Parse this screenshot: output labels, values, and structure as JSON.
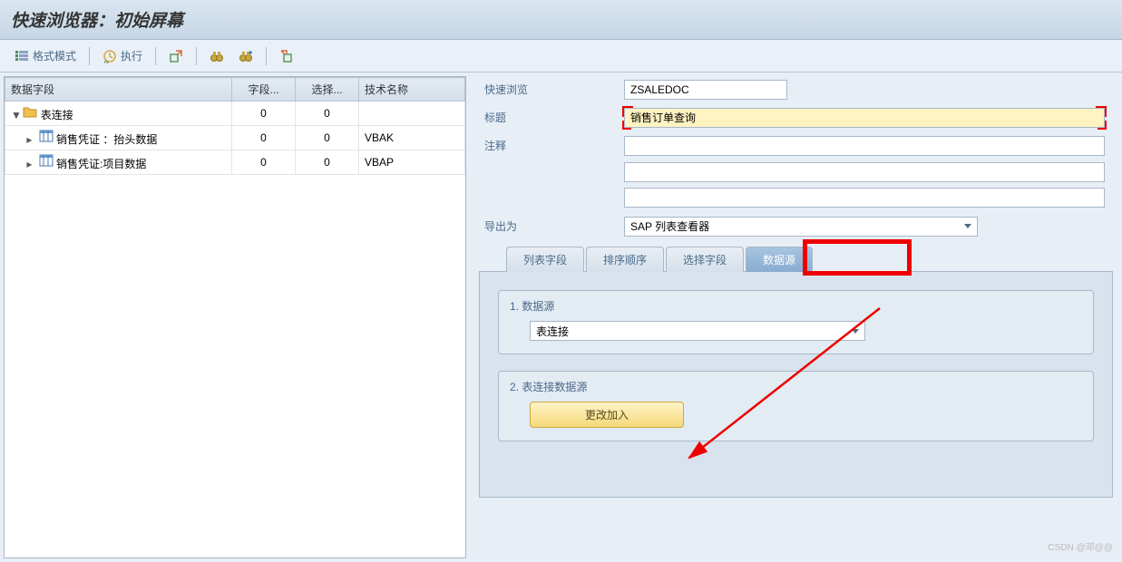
{
  "title": "快速浏览器：初始屏幕",
  "toolbar": {
    "format_mode": "格式模式",
    "execute": "执行"
  },
  "tree": {
    "headers": {
      "field": "数据字段",
      "field_count": "字段...",
      "select": "选择...",
      "tech_name": "技术名称"
    },
    "rows": [
      {
        "indent": 0,
        "toggle": "▼",
        "icon": "folder",
        "name": "表连接",
        "c1": "0",
        "c2": "0",
        "tech": ""
      },
      {
        "indent": 1,
        "toggle": "▸",
        "icon": "table",
        "name": "销售凭证 ：抬头数据",
        "c1": "0",
        "c2": "0",
        "tech": "VBAK"
      },
      {
        "indent": 1,
        "toggle": "▸",
        "icon": "table",
        "name": "销售凭证:项目数据",
        "c1": "0",
        "c2": "0",
        "tech": "VBAP"
      }
    ]
  },
  "form": {
    "quick_view_label": "快速浏览",
    "quick_view_value": "ZSALEDOC",
    "title_label": "标题",
    "title_value": "销售订单查询",
    "comment_label": "注释",
    "comment_value": "",
    "blank1": "",
    "blank2": "",
    "export_label": "导出为",
    "export_value": "SAP 列表查看器"
  },
  "tabs": {
    "t1": "列表字段",
    "t2": "排序顺序",
    "t3": "选择字段",
    "t4": "数据源"
  },
  "group1": {
    "title": "1. 数据源",
    "value": "表连接"
  },
  "group2": {
    "title": "2. 表连接数据源",
    "button": "更改加入"
  },
  "watermark": "CSDN @邓@@"
}
